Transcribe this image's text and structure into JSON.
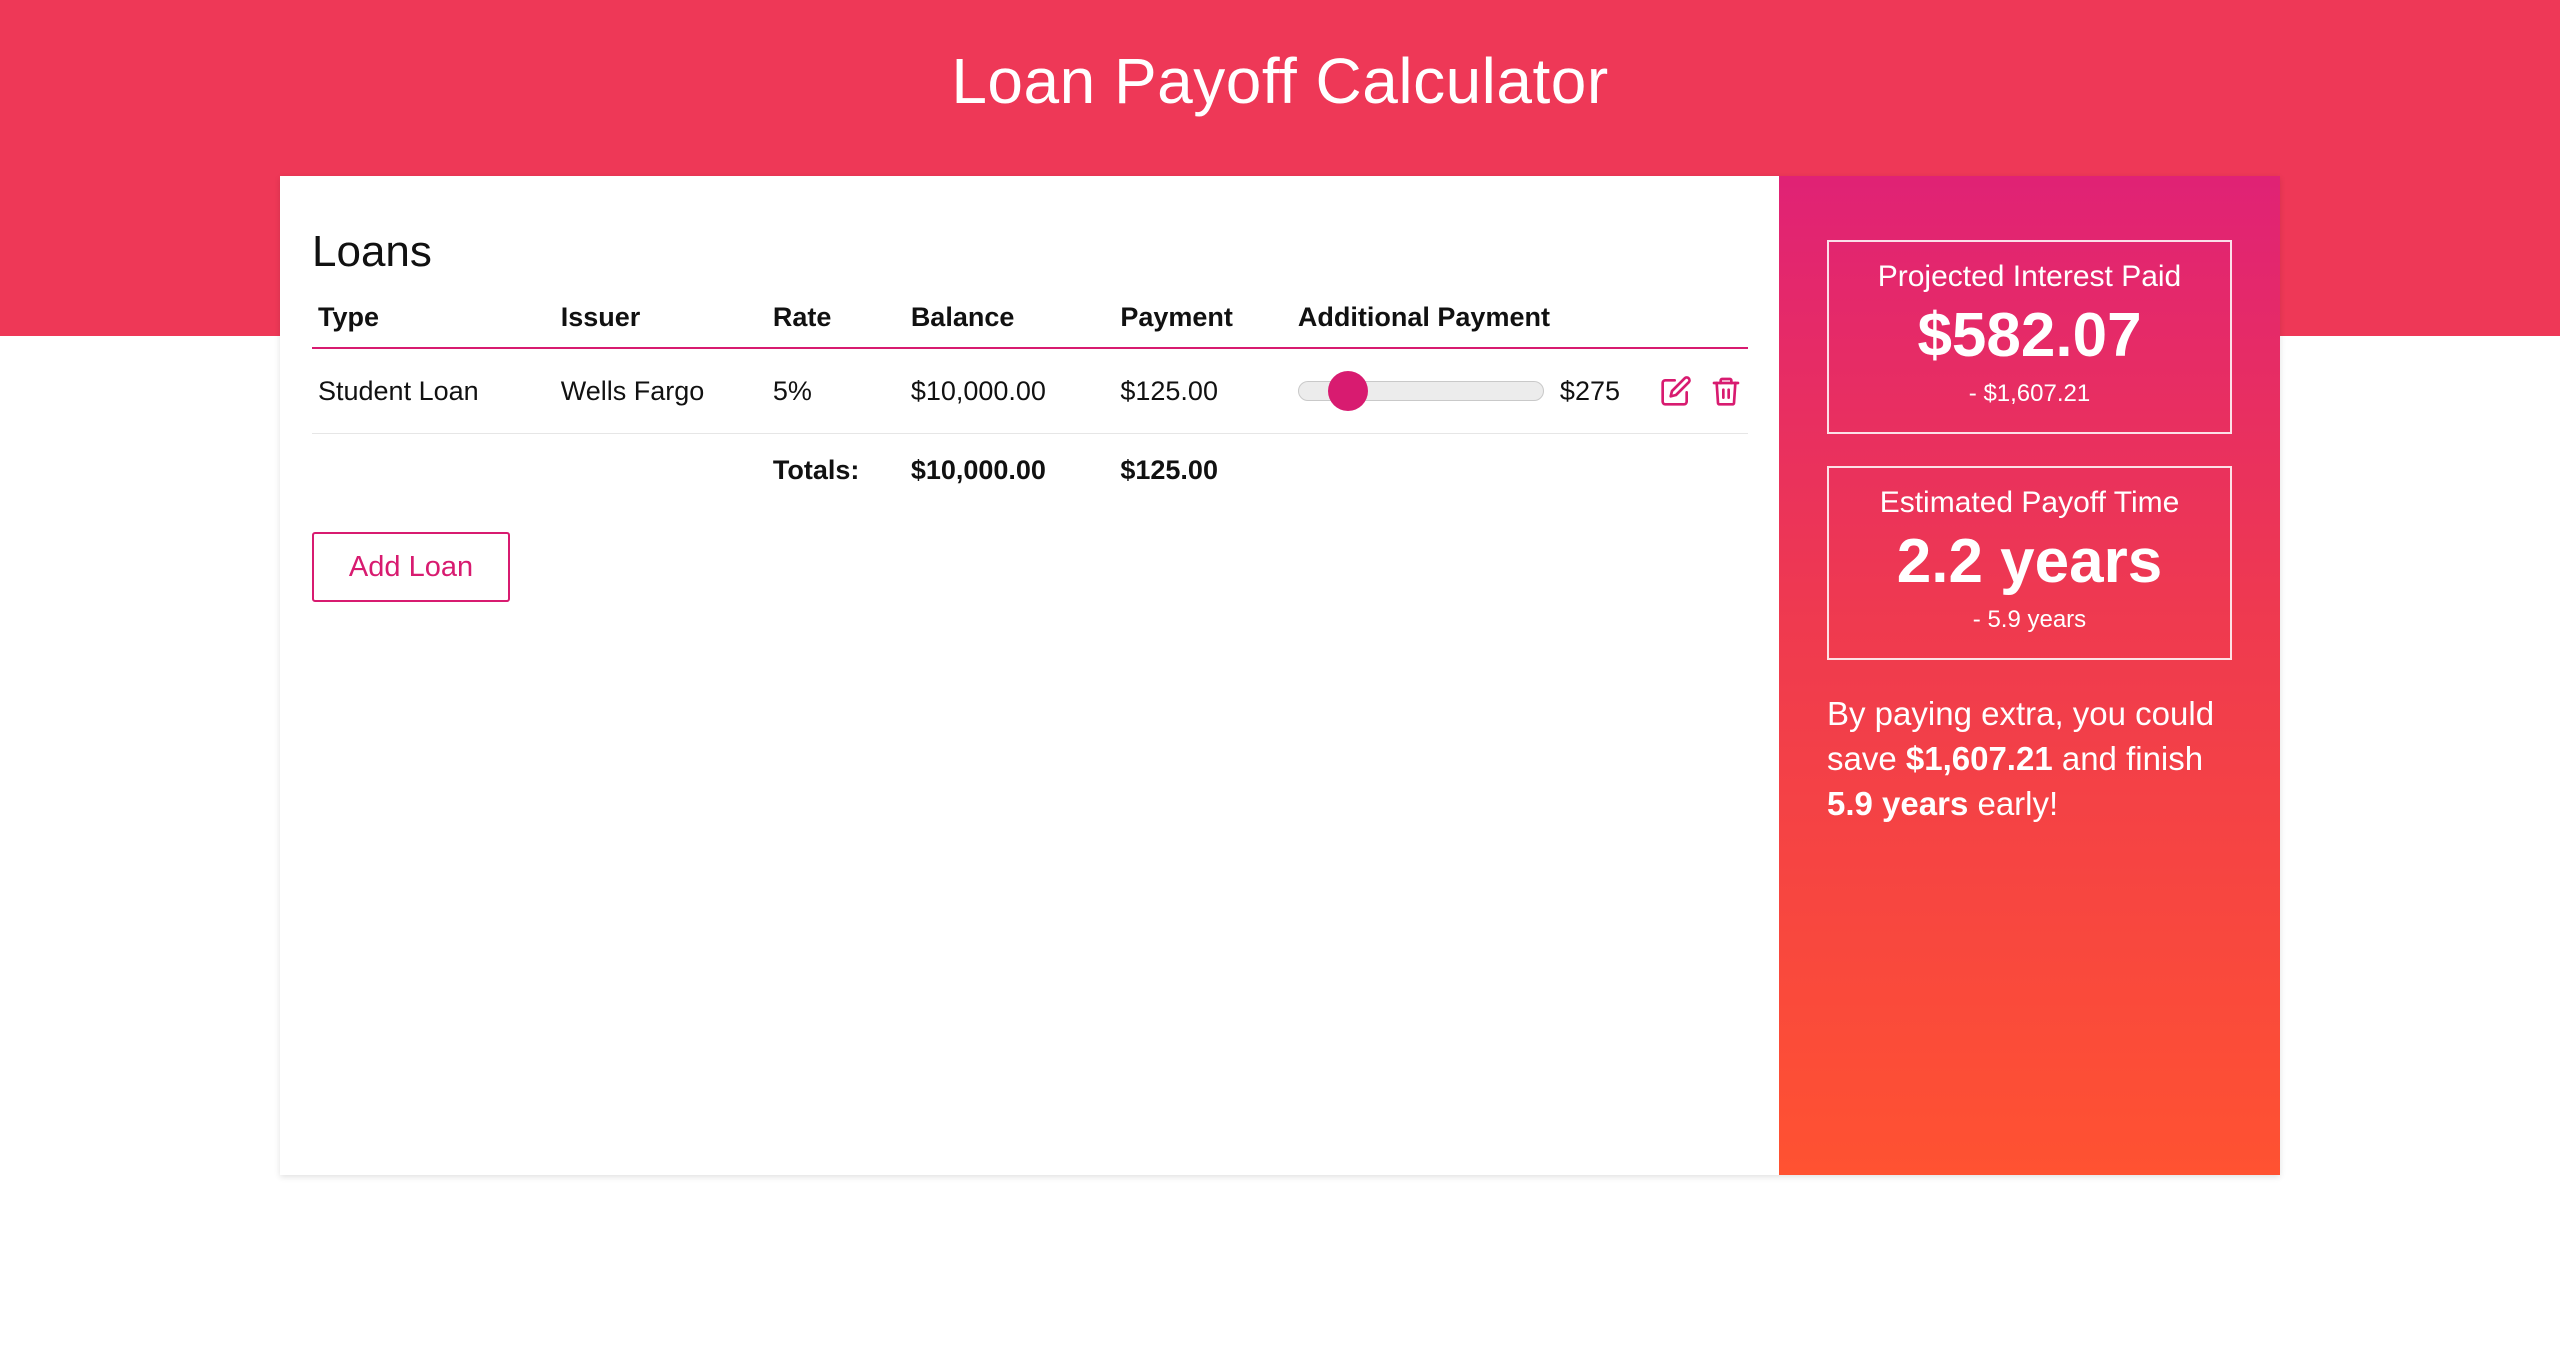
{
  "header": {
    "title": "Loan Payoff Calculator"
  },
  "loans": {
    "heading": "Loans",
    "columns": [
      "Type",
      "Issuer",
      "Rate",
      "Balance",
      "Payment",
      "Additional Payment"
    ],
    "rows": [
      {
        "type": "Student Loan",
        "issuer": "Wells Fargo",
        "rate": "5%",
        "balance": "$10,000.00",
        "payment": "$125.00",
        "additional_payment_display": "$275",
        "additional_payment_slider_fraction": 0.2,
        "edit_icon": "edit-icon",
        "delete_icon": "trash-icon"
      }
    ],
    "totals": {
      "label": "Totals:",
      "balance": "$10,000.00",
      "payment": "$125.00"
    },
    "add_button_label": "Add Loan"
  },
  "summary": {
    "interest": {
      "label": "Projected Interest Paid",
      "value": "$582.07",
      "delta": "- $1,607.21"
    },
    "payoff": {
      "label": "Estimated Payoff Time",
      "value": "2.2 years",
      "delta": "- 5.9 years"
    },
    "message": {
      "part1": "By paying extra, you could save ",
      "savings": "$1,607.21",
      "part2": " and finish ",
      "time": "5.9 years",
      "part3": " early!"
    }
  },
  "colors": {
    "header": "#ee3857",
    "accent": "#d81b70",
    "gradient_top": "#e02275",
    "gradient_bottom": "#ff5231"
  }
}
